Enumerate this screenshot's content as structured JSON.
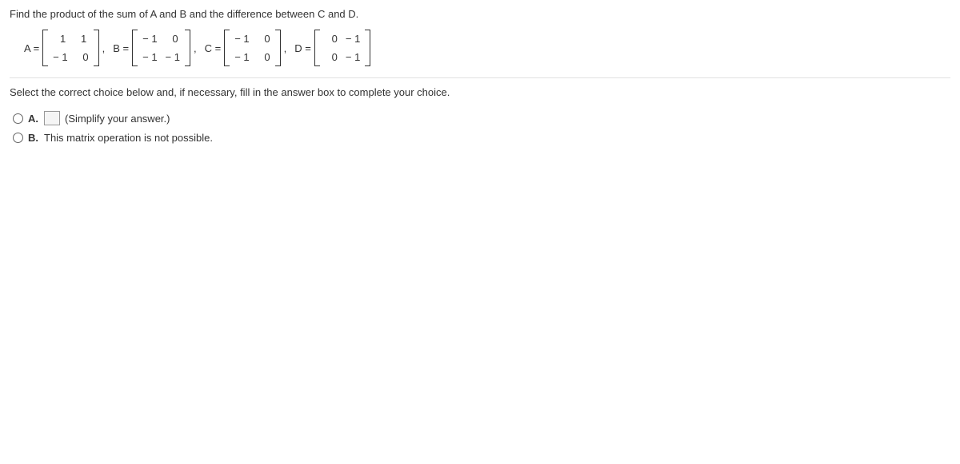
{
  "question": "Find the product of the sum of A and B and the difference between C and D.",
  "matrices": {
    "A": {
      "label": "A =",
      "rows": [
        [
          "1",
          "1"
        ],
        [
          "− 1",
          "0"
        ]
      ]
    },
    "B": {
      "label": "B =",
      "rows": [
        [
          "− 1",
          "0"
        ],
        [
          "− 1",
          "− 1"
        ]
      ]
    },
    "C": {
      "label": "C =",
      "rows": [
        [
          "− 1",
          "0"
        ],
        [
          "− 1",
          "0"
        ]
      ]
    },
    "D": {
      "label": "D =",
      "rows": [
        [
          "0",
          "− 1"
        ],
        [
          "0",
          "− 1"
        ]
      ]
    }
  },
  "instruction": "Select the correct choice below and, if necessary, fill in the answer box to complete your choice.",
  "choices": {
    "A": {
      "label": "A.",
      "text": "(Simplify your answer.)"
    },
    "B": {
      "label": "B.",
      "text": "This matrix operation is not possible."
    }
  }
}
